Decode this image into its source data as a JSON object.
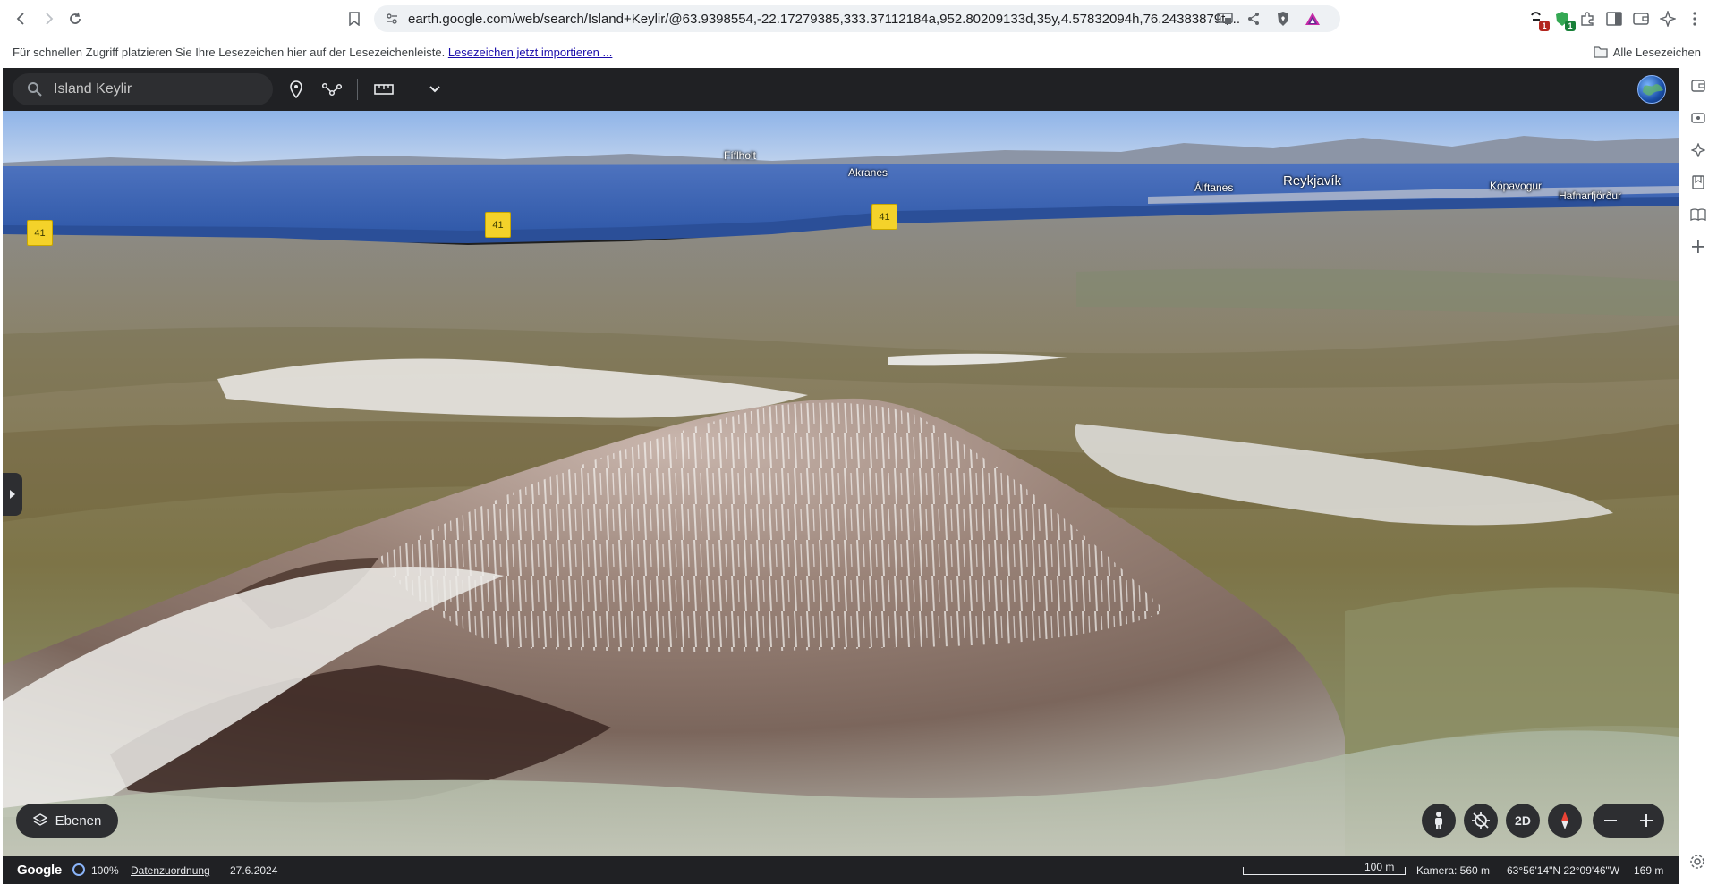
{
  "browser": {
    "url": "earth.google.com/web/search/Island+Keylir/@63.9398554,-22.17279385,333.37112184a,952.80209133d,35y,4.57832094h,76.24383879t,...",
    "extensions": [
      {
        "name": "shield-extension",
        "badge": "1",
        "badge_color": "#b3261e"
      },
      {
        "name": "green-extension",
        "badge": "1",
        "badge_color": "#188038"
      }
    ]
  },
  "bookmarks": {
    "hint": "Für schnellen Zugriff platzieren Sie Ihre Lesezeichen hier auf der Lesezeichenleiste.",
    "import_link": "Lesezeichen jetzt importieren ...",
    "all_bookmarks": "Alle Lesezeichen"
  },
  "earth": {
    "search": {
      "value": "Island Keylir"
    },
    "labels": {
      "fiflholt": "Fíflholt",
      "akranes": "Akranes",
      "alftanes": "Álftanes",
      "reykjavik": "Reykjavík",
      "kopavogur": "Kópavogur",
      "hafnarfjordur": "Hafnarfjörður"
    },
    "road_shields": [
      "41",
      "41",
      "41"
    ],
    "layers_button": "Ebenen",
    "view_mode": "2D",
    "status": {
      "google": "Google",
      "load_percent": "100%",
      "attribution": "Datenzuordnung",
      "date": "27.6.2024",
      "scale": "100 m",
      "camera": "Kamera: 560 m",
      "coords": "63°56'14\"N 22°09'46\"W",
      "elevation": "169 m"
    },
    "colors": {
      "toolbar": "#202124",
      "accent": "#8ab4f8",
      "shield": "#f4d22a"
    }
  }
}
